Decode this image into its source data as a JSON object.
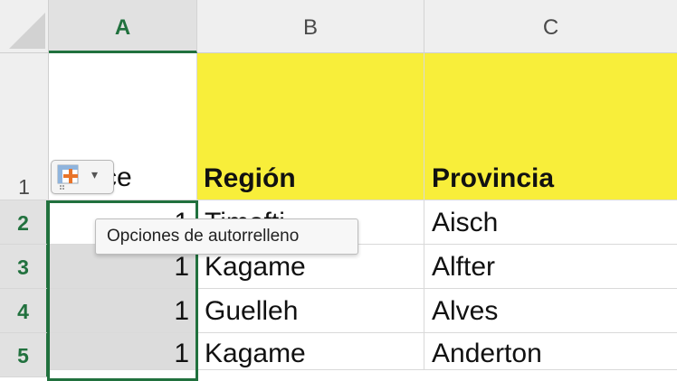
{
  "columns": [
    {
      "label": "A",
      "selected": true
    },
    {
      "label": "B",
      "selected": false
    },
    {
      "label": "C",
      "selected": false
    }
  ],
  "rows": [
    {
      "label": "1",
      "selected": false
    },
    {
      "label": "2",
      "selected": true
    },
    {
      "label": "3",
      "selected": true
    },
    {
      "label": "4",
      "selected": true
    },
    {
      "label": "5",
      "selected": true
    }
  ],
  "cells": {
    "A1_visible": "ce",
    "B1": "Región",
    "C1": "Provincia",
    "A2": "1",
    "B2": "Timofti",
    "C2": "Aisch",
    "A3": "1",
    "B3": "Kagame",
    "C3": "Alfter",
    "A4": "1",
    "B4": "Guelleh",
    "C4": "Alves",
    "A5": "1",
    "B5": "Kagame",
    "C5": "Anderton"
  },
  "autofill": {
    "icon": "autofill-options-icon",
    "caret": "▾",
    "tooltip": "Opciones de autorrelleno"
  },
  "colors": {
    "header_fill": "#f8ee3a",
    "selection": "#21713e",
    "selected_fill": "#dcdcdc"
  }
}
